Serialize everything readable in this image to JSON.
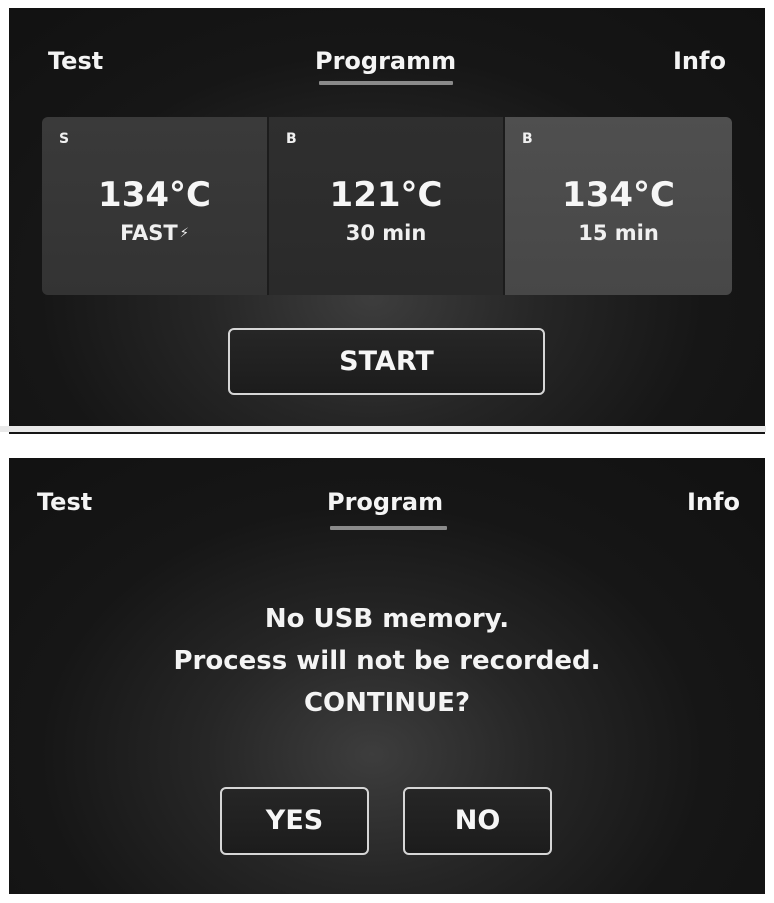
{
  "screen1": {
    "tabs": {
      "left": "Test",
      "center": "Programm",
      "right": "Info"
    },
    "programs": [
      {
        "type": "S",
        "temperature": "134°C",
        "detail": "FAST",
        "detail_icon": "lightning-bolt-icon"
      },
      {
        "type": "B",
        "temperature": "121°C",
        "detail": "30 min"
      },
      {
        "type": "B",
        "temperature": "134°C",
        "detail": "15 min"
      }
    ],
    "start_label": "START"
  },
  "screen2": {
    "tabs": {
      "left": "Test",
      "center": "Program",
      "right": "Info"
    },
    "message_lines": [
      "No USB memory.",
      "Process will not be recorded.",
      "CONTINUE?"
    ],
    "yes_label": "YES",
    "no_label": "NO"
  },
  "colors": {
    "screen_background": "#161616",
    "card_selected": "#4f4f4f",
    "tab_underline": "#8a8a8a",
    "button_border": "#d6d6d6"
  }
}
